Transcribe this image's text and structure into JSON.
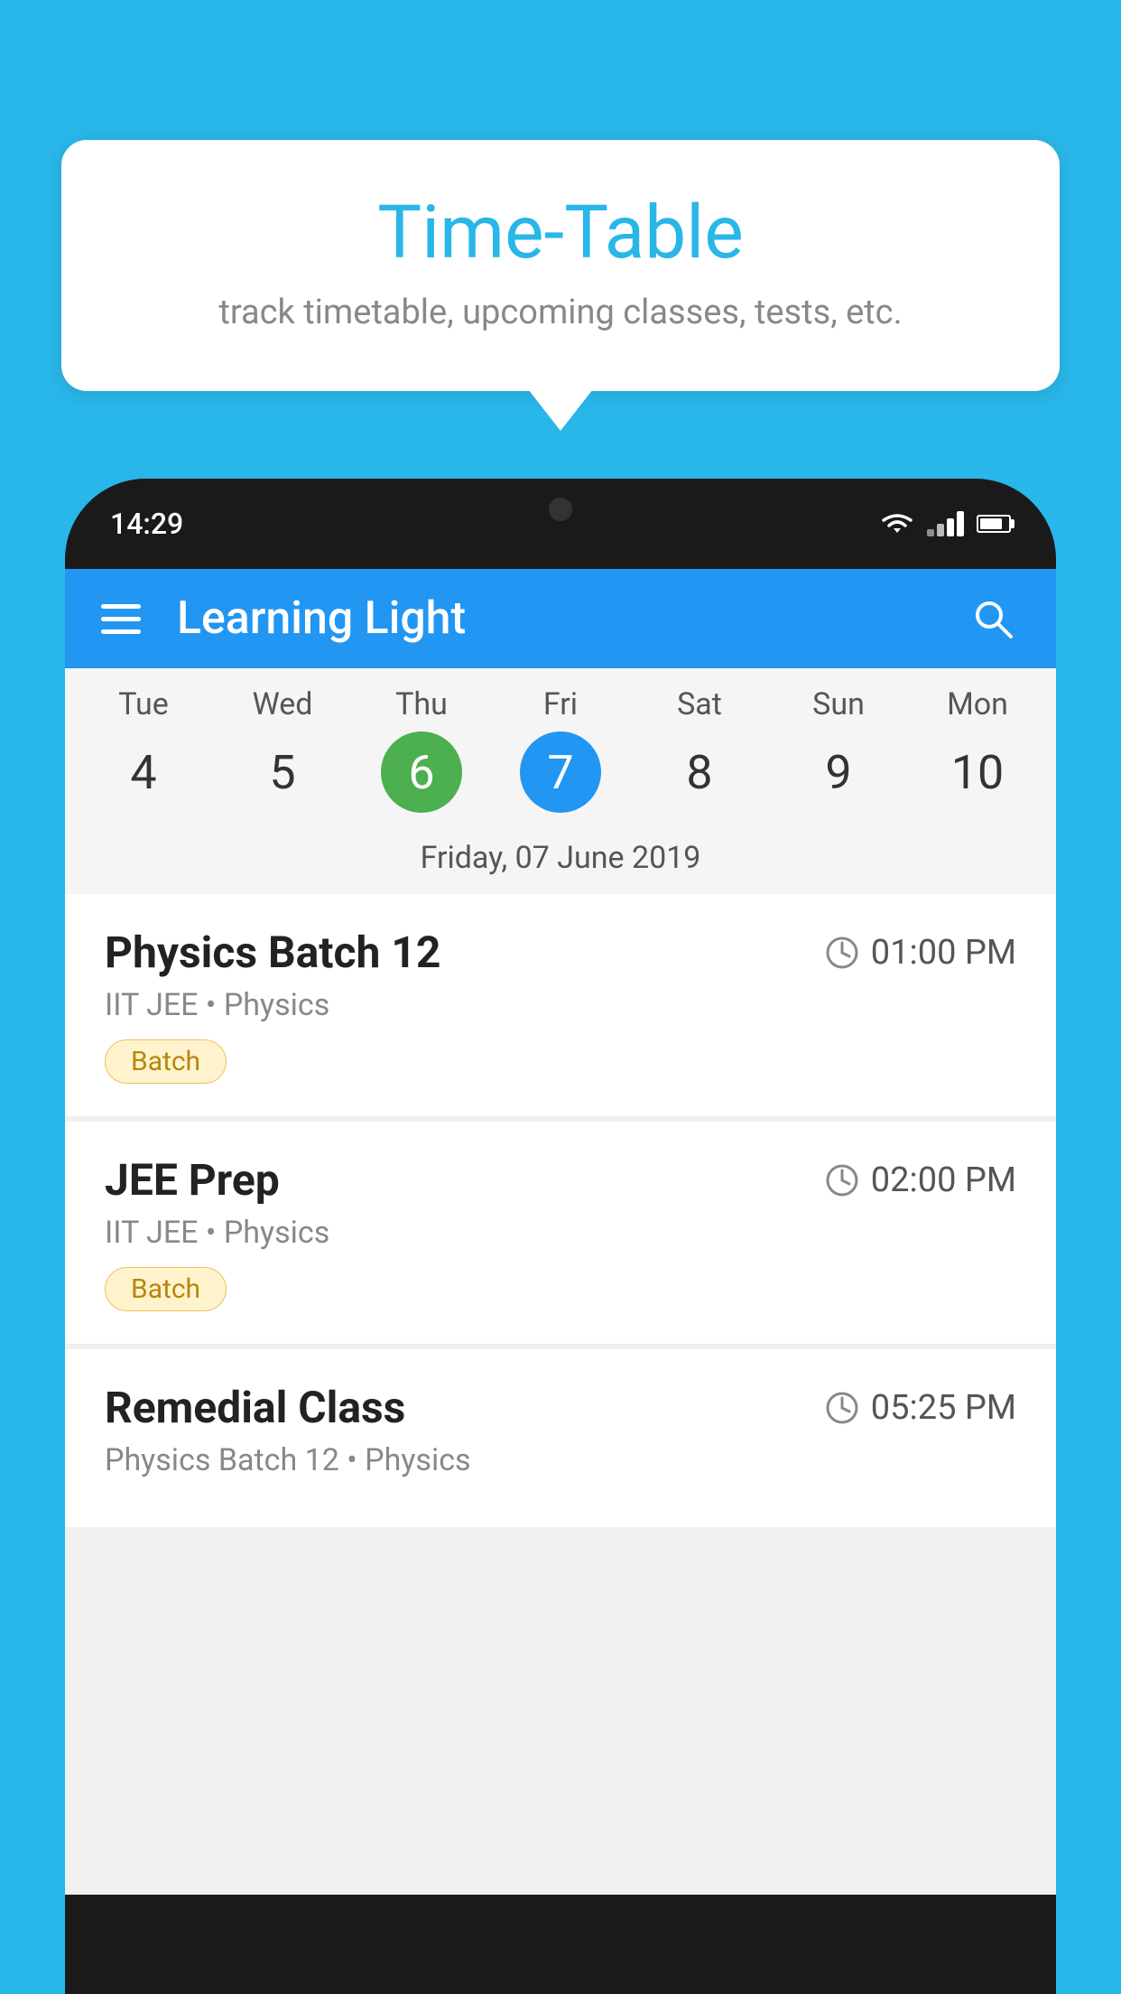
{
  "background_color": "#29b6e8",
  "tooltip": {
    "title": "Time-Table",
    "subtitle": "track timetable, upcoming classes, tests, etc."
  },
  "phone": {
    "status_bar": {
      "time": "14:29"
    },
    "app_bar": {
      "title": "Learning Light"
    },
    "calendar": {
      "days": [
        {
          "name": "Tue",
          "num": "4",
          "state": "normal"
        },
        {
          "name": "Wed",
          "num": "5",
          "state": "normal"
        },
        {
          "name": "Thu",
          "num": "6",
          "state": "today"
        },
        {
          "name": "Fri",
          "num": "7",
          "state": "selected"
        },
        {
          "name": "Sat",
          "num": "8",
          "state": "normal"
        },
        {
          "name": "Sun",
          "num": "9",
          "state": "normal"
        },
        {
          "name": "Mon",
          "num": "10",
          "state": "normal"
        }
      ],
      "selected_date_label": "Friday, 07 June 2019"
    },
    "schedule": [
      {
        "title": "Physics Batch 12",
        "time": "01:00 PM",
        "subtitle": "IIT JEE • Physics",
        "badge": "Batch"
      },
      {
        "title": "JEE Prep",
        "time": "02:00 PM",
        "subtitle": "IIT JEE • Physics",
        "badge": "Batch"
      },
      {
        "title": "Remedial Class",
        "time": "05:25 PM",
        "subtitle": "Physics Batch 12 • Physics",
        "badge": null
      }
    ]
  }
}
